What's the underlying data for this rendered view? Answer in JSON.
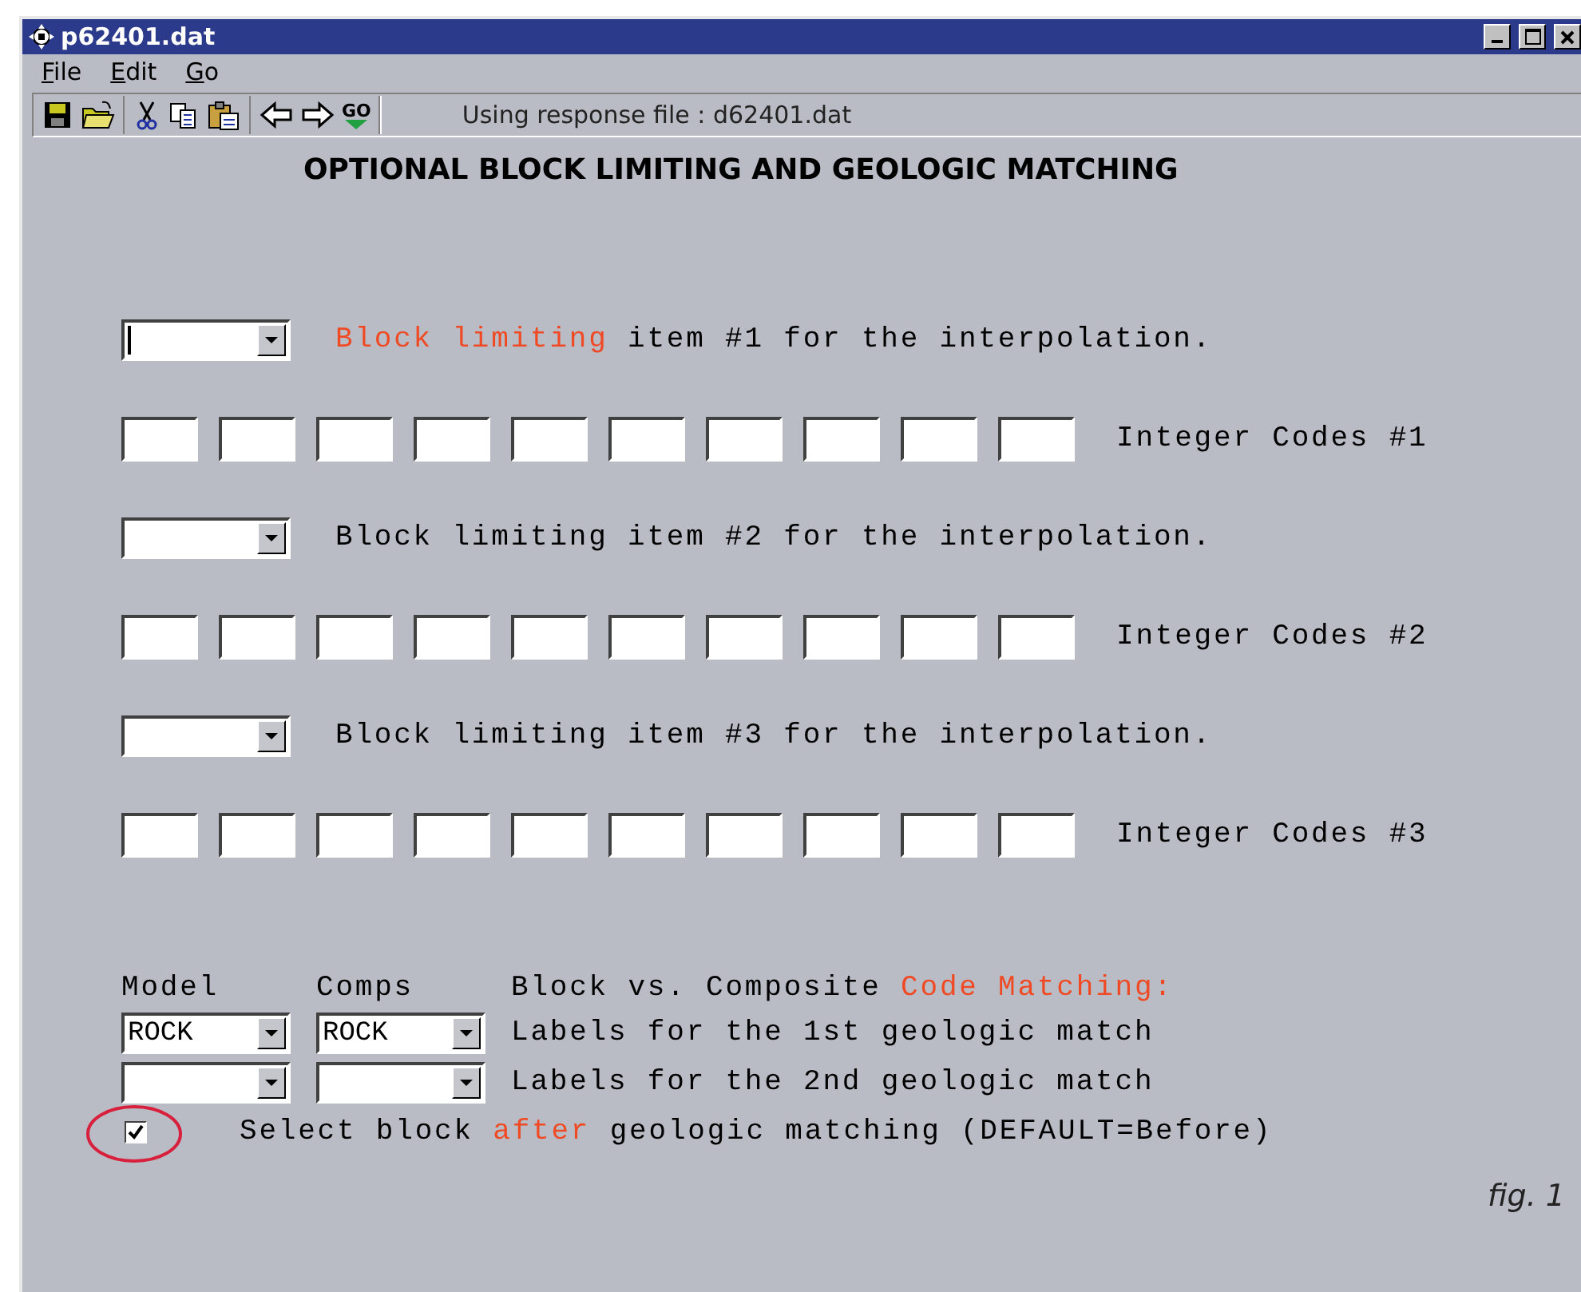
{
  "window": {
    "title": "p62401.dat"
  },
  "menu": [
    {
      "label": "File"
    },
    {
      "label": "Edit"
    },
    {
      "label": "Go"
    }
  ],
  "toolbar": {
    "status": "Using response file : d62401.dat",
    "go_label": "GO"
  },
  "heading": "OPTIONAL BLOCK LIMITING AND GEOLOGIC MATCHING",
  "block_items": [
    {
      "focused": true,
      "label": [
        {
          "text": "Block limiting",
          "highlight": true
        },
        {
          "text": " item #1 for the interpolation.",
          "highlight": false
        }
      ],
      "codes_label": "Integer Codes #1"
    },
    {
      "focused": false,
      "label": [
        {
          "text": "Block limiting item #2 for the interpolation.",
          "highlight": false
        }
      ],
      "codes_label": "Integer Codes #2"
    },
    {
      "focused": false,
      "label": [
        {
          "text": "Block limiting item #3 for the interpolation.",
          "highlight": false
        }
      ],
      "codes_label": "Integer Codes #3"
    }
  ],
  "matching": {
    "model_header": "Model",
    "comps_header": "Comps",
    "title": [
      {
        "text": "Block vs. Composite ",
        "highlight": false
      },
      {
        "text": "Code Matching:",
        "highlight": true
      }
    ],
    "rows": [
      {
        "model": "ROCK",
        "comps": "ROCK",
        "label": "Labels for the 1st geologic match"
      },
      {
        "label": "Labels for the 2nd geologic match"
      }
    ]
  },
  "after_checkbox": {
    "checked": true,
    "circled": true,
    "label": [
      {
        "text": "Select block ",
        "highlight": false
      },
      {
        "text": "after",
        "highlight": true
      },
      {
        "text": " geologic matching (DEFAULT=Before)",
        "highlight": false
      }
    ]
  },
  "caption": "fig. 1"
}
